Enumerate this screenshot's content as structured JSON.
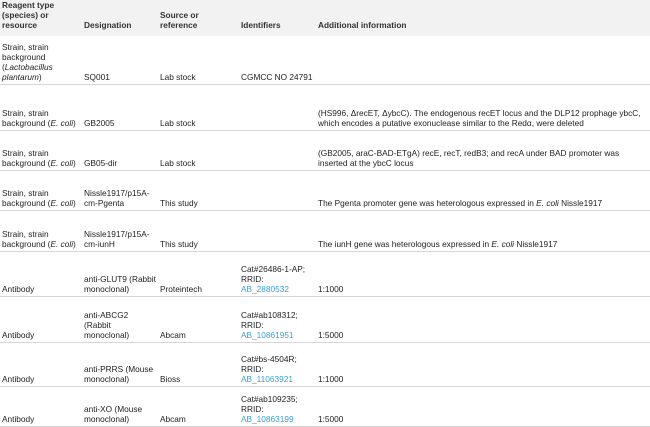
{
  "headers": {
    "type": "Reagent type (species) or resource",
    "designation": "Designation",
    "source": "Source or reference",
    "identifiers": "Identifiers",
    "info": "Additional information"
  },
  "rows": [
    {
      "type_main": "Strain, strain background (",
      "type_italic": "Lactobacillus plantarum",
      "type_end": ")",
      "designation": "SQ001",
      "source": "Lab stock",
      "id_text": "CGMCC NO 24791",
      "id_link": "",
      "info_main": "",
      "info_italic": "",
      "info_end": ""
    },
    {
      "type_main": "Strain, strain background (",
      "type_italic": "E. coli",
      "type_end": ")",
      "designation": "GB2005",
      "source": "Lab stock",
      "id_text": "",
      "id_link": "",
      "info_main": "(HS996, ΔrecET, ΔybcC). The endogenous recET locus and the DLP12 prophage ybcC, which encodes a putative exonuclease similar to the Redα, were deleted",
      "info_italic": "",
      "info_end": ""
    },
    {
      "type_main": "Strain, strain background (",
      "type_italic": "E. coli",
      "type_end": ")",
      "designation": "GB05-dir",
      "source": "Lab stock",
      "id_text": "",
      "id_link": "",
      "info_main": "(GB2005, araC-BAD-ETgA) recE, recT, redB3; and recA under BAD promoter was inserted at the ybcC locus",
      "info_italic": "",
      "info_end": ""
    },
    {
      "type_main": "Strain, strain background (",
      "type_italic": "E. coli",
      "type_end": ")",
      "designation": "Nissle1917/p15A-cm-Pgenta",
      "source": "This study",
      "id_text": "",
      "id_link": "",
      "info_main": "The Pgenta promoter gene was heterologous expressed in ",
      "info_italic": "E. coli",
      "info_end": " Nissle1917"
    },
    {
      "type_main": "Strain, strain background (",
      "type_italic": "E. coli",
      "type_end": ")",
      "designation": "Nissle1917/p15A-cm-iunH",
      "source": "This study",
      "id_text": "",
      "id_link": "",
      "info_main": "The iunH gene was heterologous expressed in ",
      "info_italic": "E. coli",
      "info_end": " Nissle1917"
    },
    {
      "type_main": "Antibody",
      "type_italic": "",
      "type_end": "",
      "designation": "anti-GLUT9 (Rabbit monoclonal)",
      "source": "Proteintech",
      "id_text": "Cat#26486-1-AP; RRID:",
      "id_link": "AB_2880532",
      "info_main": "1:1000",
      "info_italic": "",
      "info_end": ""
    },
    {
      "type_main": "Antibody",
      "type_italic": "",
      "type_end": "",
      "designation": "anti-ABCG2 (Rabbit monoclonal)",
      "source": "Abcam",
      "id_text": "Cat#ab108312; RRID:",
      "id_link": "AB_10861951",
      "info_main": "1:5000",
      "info_italic": "",
      "info_end": ""
    },
    {
      "type_main": "Antibody",
      "type_italic": "",
      "type_end": "",
      "designation": "anti-PRRS (Mouse monoclonal)",
      "source": "Bioss",
      "id_text": "Cat#bs-4504R; RRID:",
      "id_link": "AB_11063921",
      "info_main": "1:1000",
      "info_italic": "",
      "info_end": ""
    },
    {
      "type_main": "Antibody",
      "type_italic": "",
      "type_end": "",
      "designation": "anti-XO (Mouse monoclonal)",
      "source": "Abcam",
      "id_text": "Cat#ab109235; RRID:",
      "id_link": "AB_10863199",
      "info_main": "1:5000",
      "info_italic": "",
      "info_end": ""
    }
  ]
}
